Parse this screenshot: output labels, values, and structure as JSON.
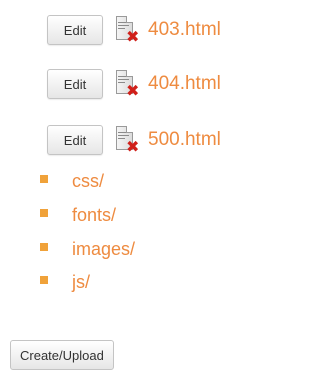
{
  "files": [
    {
      "edit_label": "Edit",
      "name": "403.html"
    },
    {
      "edit_label": "Edit",
      "name": "404.html"
    },
    {
      "edit_label": "Edit",
      "name": "500.html"
    }
  ],
  "directories": [
    {
      "name": "css/"
    },
    {
      "name": "fonts/"
    },
    {
      "name": "images/"
    },
    {
      "name": "js/"
    }
  ],
  "actions": {
    "create_upload_label": "Create/Upload"
  },
  "colors": {
    "link": "#ee8b40",
    "bullet": "#f0a23a",
    "delete_mark": "#d0201a"
  },
  "icons": {
    "file": "file-delete-icon",
    "bullet": "folder-bullet-icon"
  }
}
